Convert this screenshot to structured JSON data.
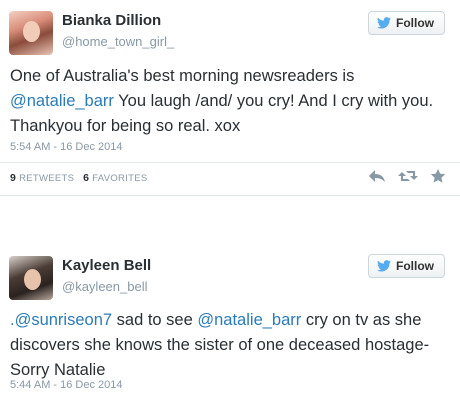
{
  "tweets": [
    {
      "name": "Bianka Dillion",
      "handle": "@home_town_girl_",
      "follow_label": "Follow",
      "text_parts": [
        "One of Australia's best morning newsreaders is ",
        "@natalie_barr",
        "  You laugh /and/ you cry! And I cry with you. Thankyou for being so real. xox"
      ],
      "time": "5:54 AM - 16 Dec 2014",
      "retweets_count": "9",
      "retweets_label": "RETWEETS",
      "favorites_count": "6",
      "favorites_label": "FAVORITES"
    },
    {
      "name": "Kayleen Bell",
      "handle": "@kayleen_bell",
      "follow_label": "Follow",
      "text_parts": [
        ".@sunriseon7",
        " sad to see ",
        "@natalie_barr",
        " cry on tv as she discovers she knows the sister of one deceased hostage- Sorry Natalie"
      ],
      "time": "5:44 AM - 16 Dec 2014"
    }
  ],
  "colors": {
    "mention": "#2b7bb9",
    "secondary": "#8899a6",
    "twitter_blue": "#55acee"
  },
  "icons": {
    "follow": "twitter-bird-icon",
    "reply": "reply-icon",
    "retweet": "retweet-icon",
    "favorite": "star-icon"
  }
}
